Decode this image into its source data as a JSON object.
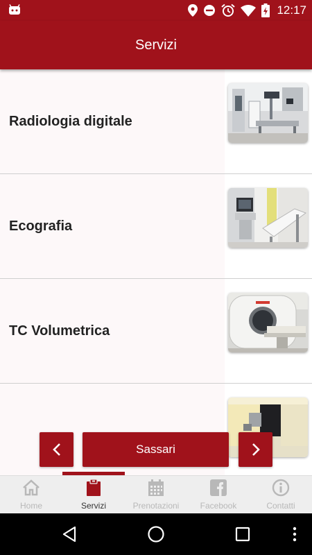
{
  "status_bar": {
    "time": "12:17",
    "icons": [
      "android-icon",
      "location-icon",
      "do-not-disturb-icon",
      "alarm-icon",
      "wifi-icon",
      "battery-charging-icon"
    ]
  },
  "app_bar": {
    "title": "Servizi"
  },
  "services": [
    {
      "label": "Radiologia digitale",
      "image": "radiology-room-photo"
    },
    {
      "label": "Ecografia",
      "image": "ultrasound-room-photo"
    },
    {
      "label": "TC Volumetrica",
      "image": "ct-scanner-photo"
    },
    {
      "label": "",
      "image": "equipment-room-photo"
    }
  ],
  "city_nav": {
    "prev_icon": "chevron-left-icon",
    "city": "Sassari",
    "next_icon": "chevron-right-icon"
  },
  "tabs": [
    {
      "label": "Home",
      "icon": "home-icon",
      "active": false
    },
    {
      "label": "Servizi",
      "icon": "clipboard-icon",
      "active": true
    },
    {
      "label": "Prenotazioni",
      "icon": "calendar-icon",
      "active": false
    },
    {
      "label": "Facebook",
      "icon": "facebook-icon",
      "active": false
    },
    {
      "label": "Contatti",
      "icon": "info-icon",
      "active": false
    }
  ],
  "colors": {
    "brand": "#a0121b",
    "tab_inactive": "#b8b8b8",
    "tab_active": "#333333"
  }
}
